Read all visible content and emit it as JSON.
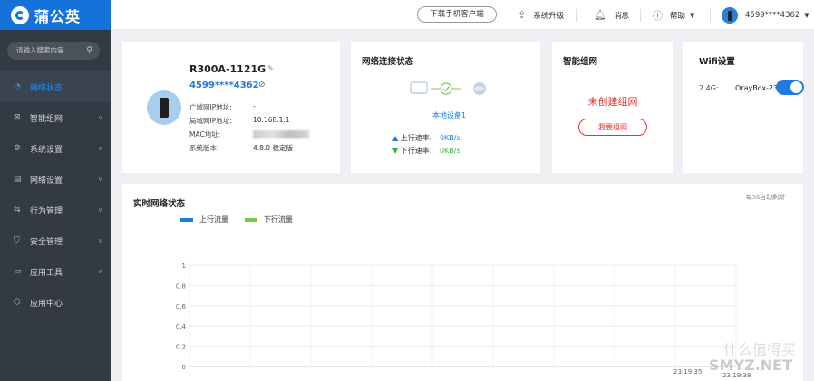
{
  "brand": {
    "name": "蒲公英"
  },
  "topbar": {
    "download_label": "下载手机客户端",
    "upgrade_label": "系统升级",
    "messages_label": "消息",
    "help_label": "帮助",
    "account_label": "4599****4362"
  },
  "sidebar": {
    "search_placeholder": "请输入搜索内容",
    "items": [
      {
        "label": "网络状态",
        "icon": "signal-icon",
        "active": true
      },
      {
        "label": "智能组网",
        "icon": "mesh-icon"
      },
      {
        "label": "系统设置",
        "icon": "gear-icon"
      },
      {
        "label": "网络设置",
        "icon": "network-icon"
      },
      {
        "label": "行为管理",
        "icon": "behavior-icon"
      },
      {
        "label": "安全管理",
        "icon": "shield-icon"
      },
      {
        "label": "应用工具",
        "icon": "tools-icon"
      },
      {
        "label": "应用中心",
        "icon": "apps-icon"
      }
    ]
  },
  "device": {
    "name": "R300A-1121G",
    "account": "4599****4362",
    "wan_ip_label": "广域网IP地址:",
    "wan_ip_value": "-",
    "lan_ip_label": "局域网IP地址:",
    "lan_ip_value": "10.168.1.1",
    "mac_label": "MAC地址:",
    "mac_value": "",
    "version_label": "系统版本:",
    "version_value": "4.8.0 稳定版"
  },
  "network_status": {
    "title": "网络连接状态",
    "local_device": "本地设备1",
    "up_label": "上行速率:",
    "up_value": "0KB/s",
    "down_label": "下行速率:",
    "down_value": "0KB/s"
  },
  "mesh": {
    "title": "智能组网",
    "message": "未创建组网",
    "button_label": "我要组网"
  },
  "wifi": {
    "title": "Wifi设置",
    "band_label": "2.4G:",
    "ssid": "OrayBox-23",
    "enabled": true
  },
  "realtime": {
    "title": "实时网络状态",
    "refresh_note": "每5s自动刷新"
  },
  "colors": {
    "accent": "#1e7be0",
    "upload": "#1e7be0",
    "download": "#7cc84e",
    "danger": "#e5332a",
    "sidebar_bg": "#333a43"
  },
  "watermark": {
    "line1": "什么值得买",
    "line2": "SMYZ.NET"
  },
  "chart_data": {
    "type": "line",
    "title": "",
    "series": [
      {
        "name": "上行流量",
        "color": "#1e7be0",
        "values": []
      },
      {
        "name": "下行流量",
        "color": "#7cc84e",
        "values": []
      }
    ],
    "y_ticks": [
      "0",
      "0.2",
      "0.4",
      "0.6",
      "0.8",
      "1"
    ],
    "ylim": [
      0,
      1
    ],
    "x_ticks": [
      "23:19:35",
      "23:19:38"
    ],
    "grid": true,
    "legend": "top-left"
  }
}
